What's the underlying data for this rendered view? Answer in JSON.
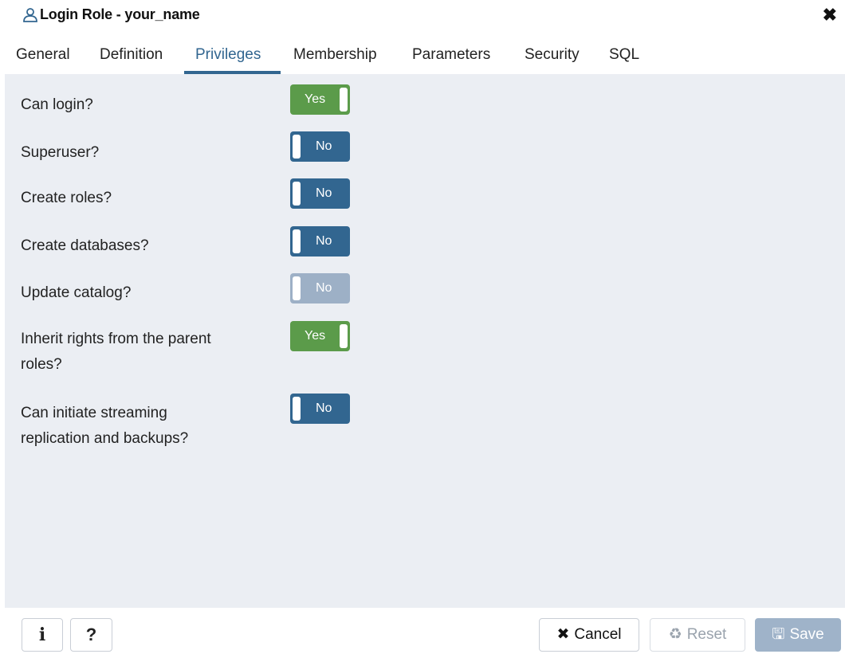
{
  "window": {
    "title": "Login Role - your_name",
    "close_glyph": "✖"
  },
  "tabs": [
    {
      "label": "General"
    },
    {
      "label": "Definition"
    },
    {
      "label": "Privileges",
      "active": true
    },
    {
      "label": "Membership"
    },
    {
      "label": "Parameters"
    },
    {
      "label": "Security"
    },
    {
      "label": "SQL"
    }
  ],
  "privileges": [
    {
      "label": "Can login?",
      "value": "Yes",
      "enabled": true
    },
    {
      "label": "Superuser?",
      "value": "No",
      "enabled": true
    },
    {
      "label": "Create roles?",
      "value": "No",
      "enabled": true
    },
    {
      "label": "Create databases?",
      "value": "No",
      "enabled": true
    },
    {
      "label": "Update catalog?",
      "value": "No",
      "enabled": false
    },
    {
      "label": "Inherit rights from the parent roles?",
      "value": "Yes",
      "enabled": true
    },
    {
      "label": "Can initiate streaming replication and backups?",
      "value": "No",
      "enabled": true
    }
  ],
  "footer": {
    "info_label": "i",
    "help_label": "?",
    "cancel_icon": "✖",
    "cancel_label": "Cancel",
    "reset_icon": "♻",
    "reset_label": "Reset",
    "save_icon": "🖫",
    "save_label": "Save"
  },
  "colors": {
    "accent": "#326690",
    "toggle_yes": "#5b9b4a",
    "toggle_no": "#326690",
    "toggle_disabled": "#9db0c6",
    "panel_bg": "#ebeef3"
  }
}
